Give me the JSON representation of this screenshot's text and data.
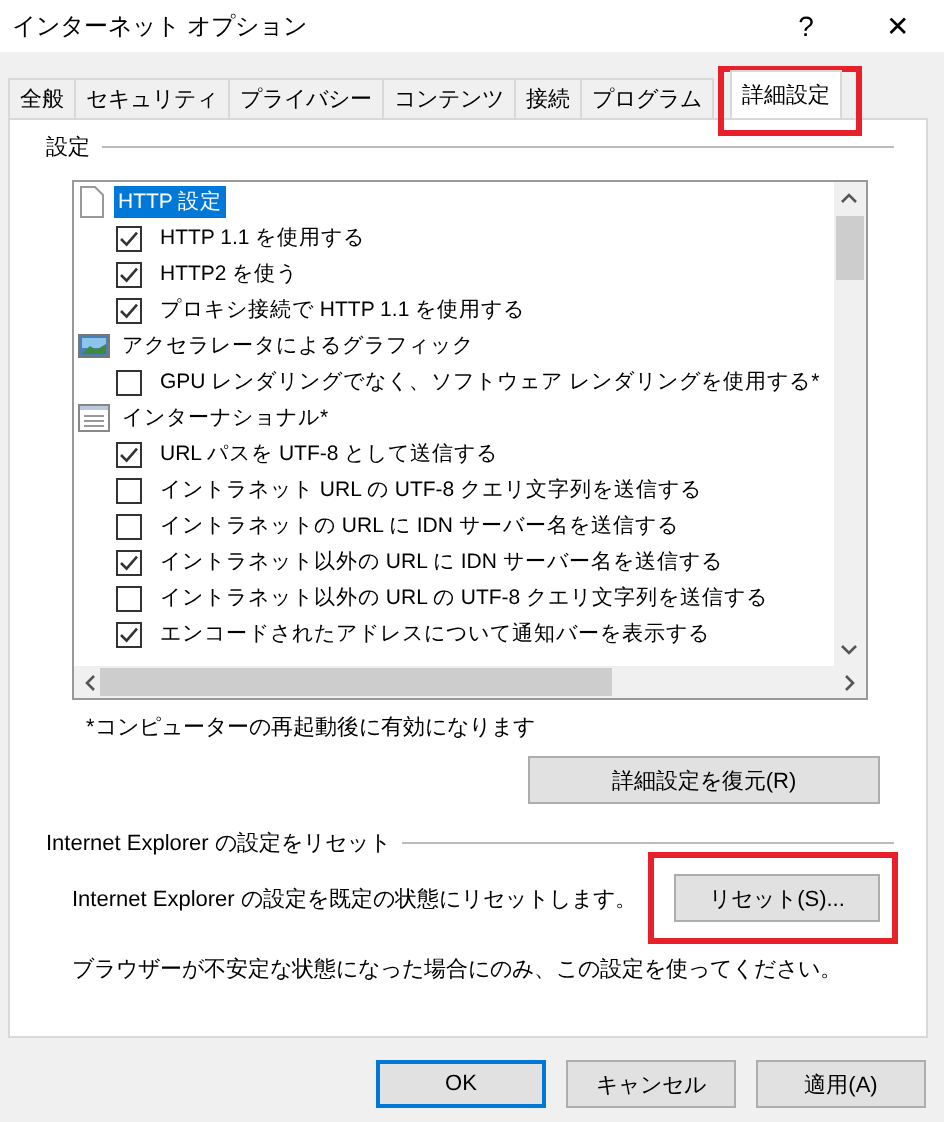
{
  "window": {
    "title": "インターネット オプション",
    "help": "?",
    "close": "✕"
  },
  "tabs": [
    {
      "label": "全般",
      "selected": false,
      "highlighted": false
    },
    {
      "label": "セキュリティ",
      "selected": false,
      "highlighted": false
    },
    {
      "label": "プライバシー",
      "selected": false,
      "highlighted": false
    },
    {
      "label": "コンテンツ",
      "selected": false,
      "highlighted": false
    },
    {
      "label": "接続",
      "selected": false,
      "highlighted": false
    },
    {
      "label": "プログラム",
      "selected": false,
      "highlighted": false
    },
    {
      "label": "詳細設定",
      "selected": true,
      "highlighted": true
    }
  ],
  "settings": {
    "heading": "設定",
    "tree": [
      {
        "kind": "document",
        "label": "HTTP 設定",
        "selected": true,
        "children": [
          {
            "kind": "checkbox",
            "label": "HTTP 1.1 を使用する",
            "checked": true,
            "selected": false
          },
          {
            "kind": "checkbox",
            "label": "HTTP2 を使う",
            "checked": true,
            "selected": false
          },
          {
            "kind": "checkbox",
            "label": "プロキシ接続で HTTP 1.1 を使用する",
            "checked": true,
            "selected": false
          }
        ]
      },
      {
        "kind": "image",
        "label": "アクセラレータによるグラフィック",
        "selected": false,
        "children": [
          {
            "kind": "checkbox",
            "label": "GPU レンダリングでなく、ソフトウェア レンダリングを使用する*",
            "checked": false,
            "selected": false
          }
        ]
      },
      {
        "kind": "window",
        "label": "インターナショナル*",
        "selected": false,
        "children": [
          {
            "kind": "checkbox",
            "label": "URL パスを UTF-8 として送信する",
            "checked": true,
            "selected": false
          },
          {
            "kind": "checkbox",
            "label": "イントラネット URL の UTF-8 クエリ文字列を送信する",
            "checked": false,
            "selected": false
          },
          {
            "kind": "checkbox",
            "label": "イントラネットの URL に IDN サーバー名を送信する",
            "checked": false,
            "selected": false
          },
          {
            "kind": "checkbox",
            "label": "イントラネット以外の URL に IDN サーバー名を送信する",
            "checked": true,
            "selected": false
          },
          {
            "kind": "checkbox",
            "label": "イントラネット以外の URL の UTF-8 クエリ文字列を送信する",
            "checked": false,
            "selected": false
          },
          {
            "kind": "checkbox",
            "label": "エンコードされたアドレスについて通知バーを表示する",
            "checked": true,
            "selected": false
          }
        ]
      }
    ],
    "footnote": "*コンピューターの再起動後に有効になります",
    "restore_button": "詳細設定を復元(R)"
  },
  "reset": {
    "heading": "Internet Explorer の設定をリセット",
    "description": "Internet Explorer の設定を既定の状態にリセットします。",
    "button": {
      "label": "リセット(S)...",
      "highlighted": true
    },
    "warning": "ブラウザーが不安定な状態になった場合にのみ、この設定を使ってください。"
  },
  "buttons": [
    {
      "label": "OK",
      "default": true
    },
    {
      "label": "キャンセル",
      "default": false
    },
    {
      "label": "適用(A)",
      "default": false
    }
  ]
}
